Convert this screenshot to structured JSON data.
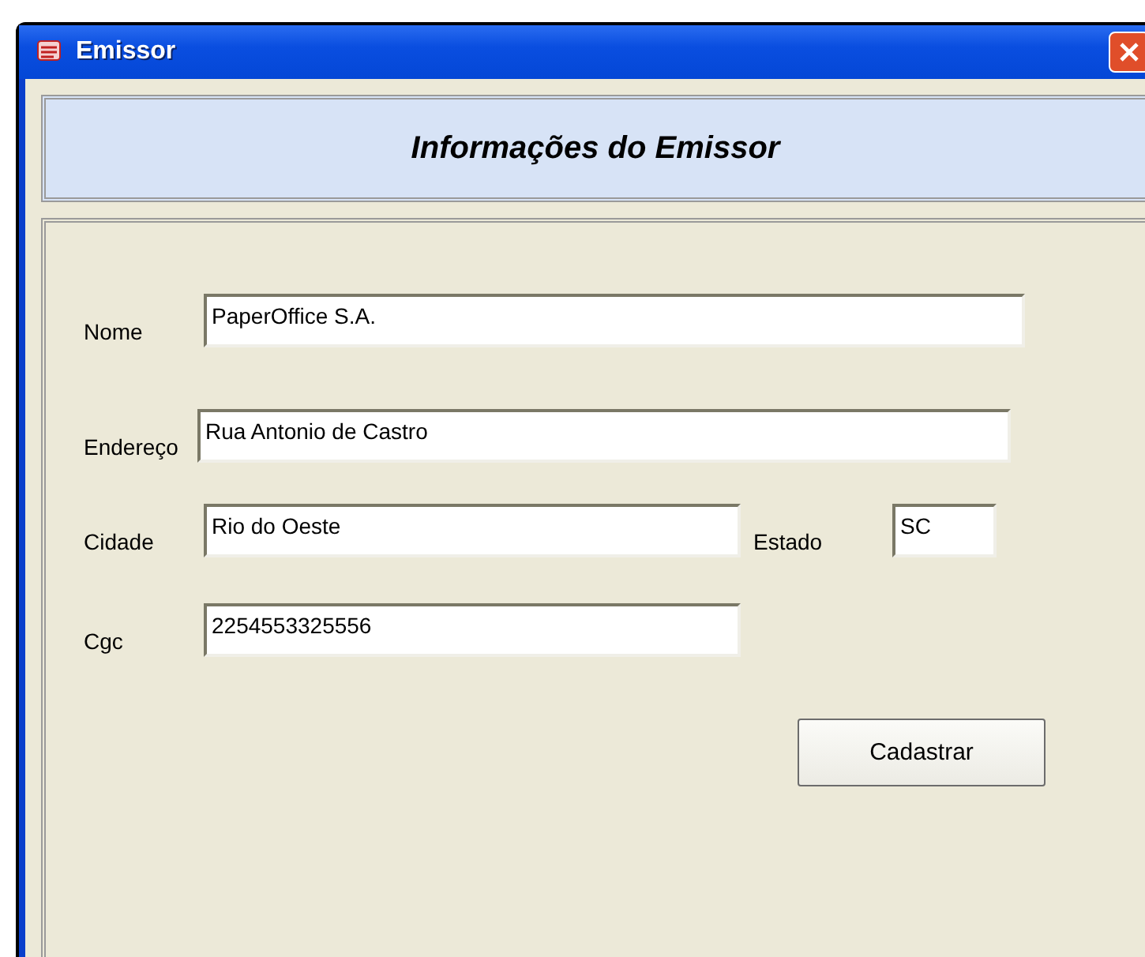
{
  "window": {
    "title": "Emissor"
  },
  "header": {
    "title": "Informações do Emissor"
  },
  "form": {
    "fields": [
      {
        "label": "Nome",
        "value": "PaperOffice S.A."
      },
      {
        "label": "Endereço",
        "value": "Rua Antonio de Castro"
      },
      {
        "label": "Cidade",
        "value": "Rio do Oeste"
      },
      {
        "label": "Estado",
        "value": "SC"
      },
      {
        "label": "Cgc",
        "value": "2254553325556"
      }
    ],
    "buttons": [
      "Cadastrar"
    ]
  }
}
